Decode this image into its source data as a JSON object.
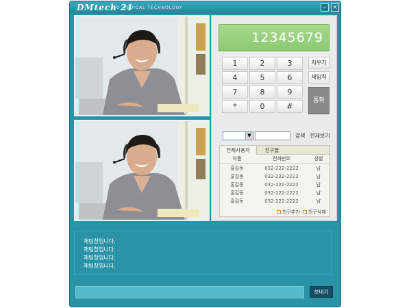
{
  "window": {
    "logo": "DMtech 21",
    "tagline": "BIO MEDICAL TECHNOLOGY",
    "minimize_icon": "minimize-icon",
    "close_icon": "close-icon"
  },
  "video": {
    "top_feed": "person-with-headset",
    "bottom_feed": "person-with-headset"
  },
  "dialer": {
    "display_number": "12345679",
    "keys": [
      "1",
      "2",
      "3",
      "4",
      "5",
      "6",
      "7",
      "8",
      "9",
      "*",
      "0",
      "#"
    ],
    "delete_label": "지우기",
    "redial_label": "재입력",
    "call_label": "통화"
  },
  "search": {
    "select_value": "",
    "input_value": "",
    "search_label": "검색",
    "view_all_label": "전체보기"
  },
  "contacts": {
    "tabs": [
      "전체사용자",
      "친구들"
    ],
    "columns": [
      "이름",
      "전화번호",
      "성별"
    ],
    "rows": [
      {
        "name": "홍길동",
        "phone": "032-222-2222",
        "gender": "남"
      },
      {
        "name": "홍길동",
        "phone": "032-222-2222",
        "gender": "남"
      },
      {
        "name": "홍길동",
        "phone": "032-222-2222",
        "gender": "남"
      },
      {
        "name": "홍길동",
        "phone": "032-222-2222",
        "gender": "남"
      },
      {
        "name": "홍길동",
        "phone": "032-222-2222",
        "gender": "남"
      }
    ],
    "add_friend_label": "친구추가",
    "delete_friend_label": "친구삭제"
  },
  "chat": {
    "messages": [
      "채팅창입니다.",
      "채팅창입니다.",
      "채팅창입니다.",
      "채팅창입니다."
    ],
    "input_value": "",
    "send_label": "보내기"
  },
  "colors": {
    "window_bg": "#2a93a8",
    "display_green": "#9bd380",
    "send_button": "#134f62"
  }
}
